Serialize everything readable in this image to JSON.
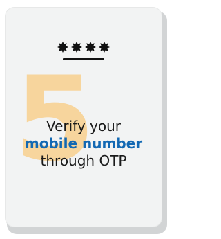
{
  "card": {
    "step_number": "5",
    "masked_code": "****",
    "line1": "Verify your",
    "line2": "mobile number",
    "line3": "through OTP"
  },
  "colors": {
    "card_background": "#f2f3f3",
    "step_number": "#f7d59d",
    "highlight_text": "#1268b3",
    "body_text": "#1a1a1a"
  },
  "icons": {
    "otp_mask": "star-icon"
  }
}
